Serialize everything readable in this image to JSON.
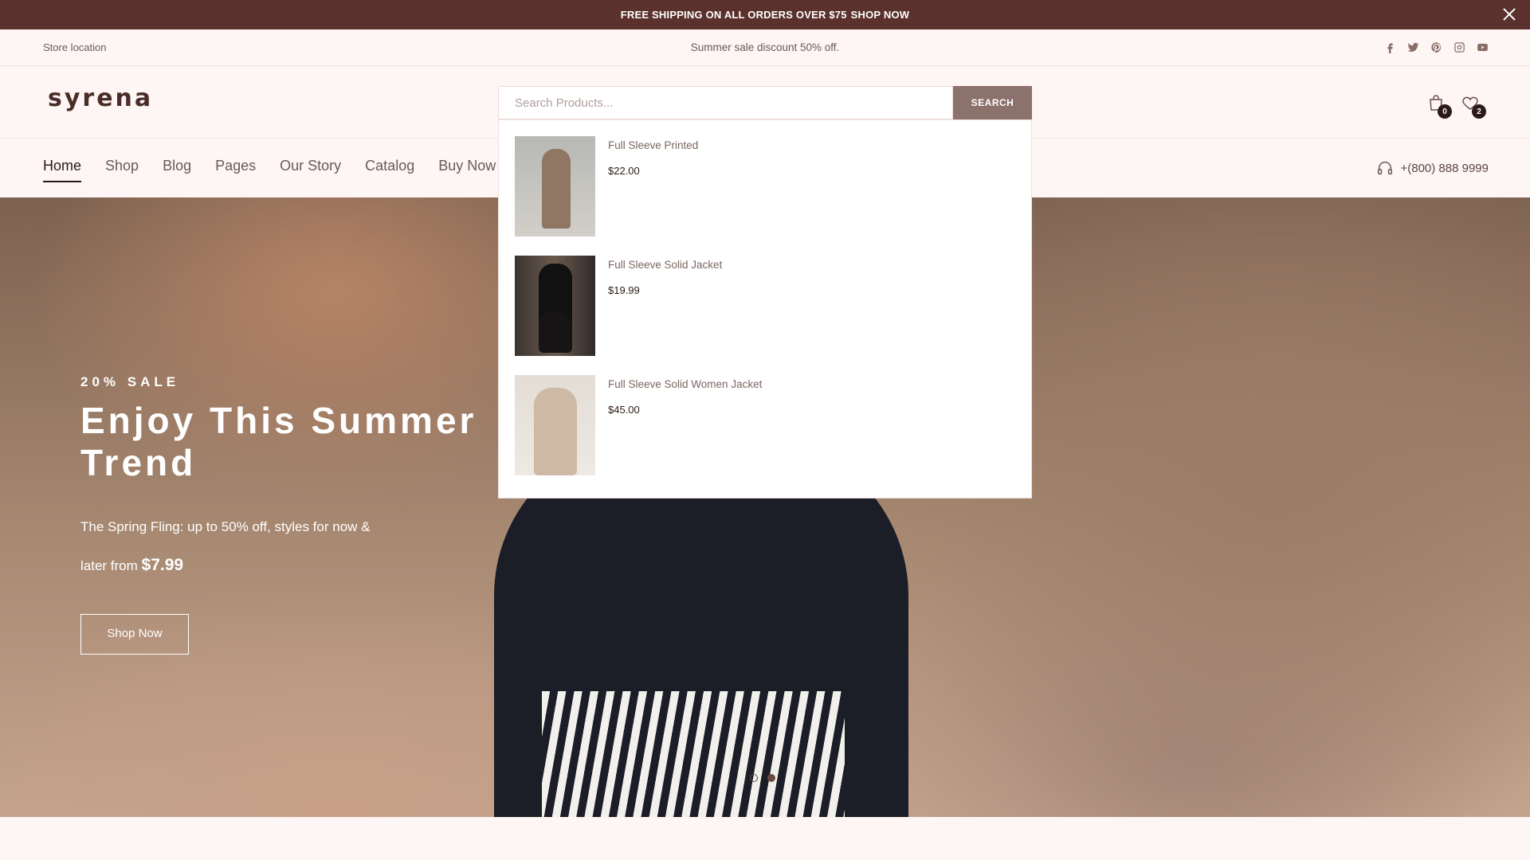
{
  "announcement": {
    "text": "FREE SHIPPING ON ALL ORDERS OVER $75",
    "link": "SHOP NOW"
  },
  "topbar": {
    "store_location": "Store location",
    "promo": "Summer sale discount 50% off.",
    "social": [
      "facebook-icon",
      "twitter-icon",
      "pinterest-icon",
      "instagram-icon",
      "youtube-icon"
    ]
  },
  "header": {
    "logo": "syrena",
    "search": {
      "placeholder": "Search Products...",
      "button": "SEARCH"
    },
    "cart_count": "0",
    "wishlist_count": "2"
  },
  "nav": {
    "items": [
      "Home",
      "Shop",
      "Blog",
      "Pages",
      "Our Story",
      "Catalog",
      "Buy Now"
    ],
    "active": "Home",
    "phone": "+(800) 888 9999"
  },
  "search_results": [
    {
      "name": "Full Sleeve Printed",
      "price": "$22.00"
    },
    {
      "name": "Full Sleeve Solid Jacket",
      "price": "$19.99"
    },
    {
      "name": "Full Sleeve Solid Women Jacket",
      "price": "$45.00"
    }
  ],
  "hero": {
    "tag": "20% SALE",
    "title": "Enjoy This Summer Trend",
    "subtitle_line1": "The Spring Fling: up to 50% off, styles for now &",
    "subtitle_line2": "later from",
    "price": "$7.99",
    "button": "Shop Now",
    "slides": 2,
    "active_slide": 2
  },
  "colors": {
    "announcement_bg": "#5a312c",
    "page_bg": "#fdf6f4",
    "search_button": "#8c726d",
    "text_dark": "#2b1a17"
  }
}
